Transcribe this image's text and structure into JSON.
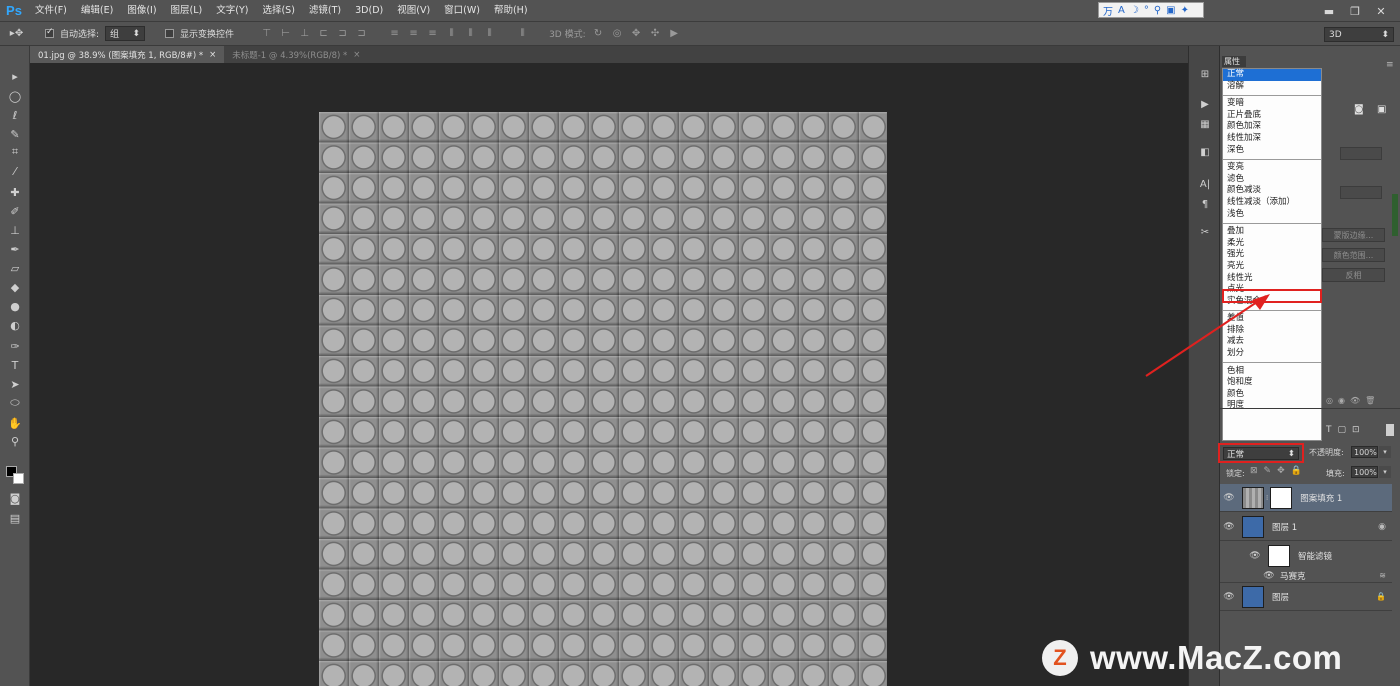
{
  "app": {
    "logo": "Ps"
  },
  "menu": [
    "文件(F)",
    "编辑(E)",
    "图像(I)",
    "图层(L)",
    "文字(Y)",
    "选择(S)",
    "滤镜(T)",
    "3D(D)",
    "视图(V)",
    "窗口(W)",
    "帮助(H)"
  ],
  "ime": {
    "text": "万 A ☽ ° ⚲ ▣ ✦",
    "icon": "ime-icon"
  },
  "options": {
    "auto_select_label": "自动选择:",
    "auto_select_value": "组",
    "show_transform_label": "显示变换控件",
    "mode_3d_label": "3D 模式:",
    "workspace": "3D"
  },
  "tabs": [
    {
      "label": "01.jpg @ 38.9% (图案填充 1, RGB/8#) *",
      "close": "×"
    },
    {
      "label": "未标题-1 @ 4.39%(RGB/8) *",
      "close": "×"
    }
  ],
  "properties": {
    "tab_label": "属性",
    "buttons": [
      "蒙版边缘...",
      "颜色范围...",
      "反相"
    ]
  },
  "blend_dropdown": {
    "selected": "正常",
    "highlighted": "线性光",
    "groups": [
      [
        "正常",
        "溶解"
      ],
      [
        "变暗",
        "正片叠底",
        "颜色加深",
        "线性加深",
        "深色"
      ],
      [
        "变亮",
        "滤色",
        "颜色减淡",
        "线性减淡（添加）",
        "浅色"
      ],
      [
        "叠加",
        "柔光",
        "强光",
        "亮光",
        "线性光",
        "点光",
        "实色混合"
      ],
      [
        "差值",
        "排除",
        "减去",
        "划分"
      ],
      [
        "色相",
        "饱和度",
        "颜色",
        "明度"
      ]
    ]
  },
  "layers_panel": {
    "blend_mode": "正常",
    "opacity_label": "不透明度:",
    "opacity": "100%",
    "lock_label": "锁定:",
    "fill_label": "填充:",
    "fill": "100%",
    "layers": [
      {
        "name": "图案填充 1",
        "selected": true
      },
      {
        "name": "图层 1",
        "selected": false
      },
      {
        "name": "智能滤镜",
        "selected": false
      },
      {
        "name": "马赛克",
        "selected": false
      },
      {
        "name": "图层",
        "selected": false
      }
    ]
  },
  "watermark": {
    "logo": "Z",
    "text": "www.MacZ.com"
  },
  "colors": {
    "accent": "#1e6fd4",
    "highlight": "#e0211f",
    "ps_blue": "#31a8ff"
  }
}
